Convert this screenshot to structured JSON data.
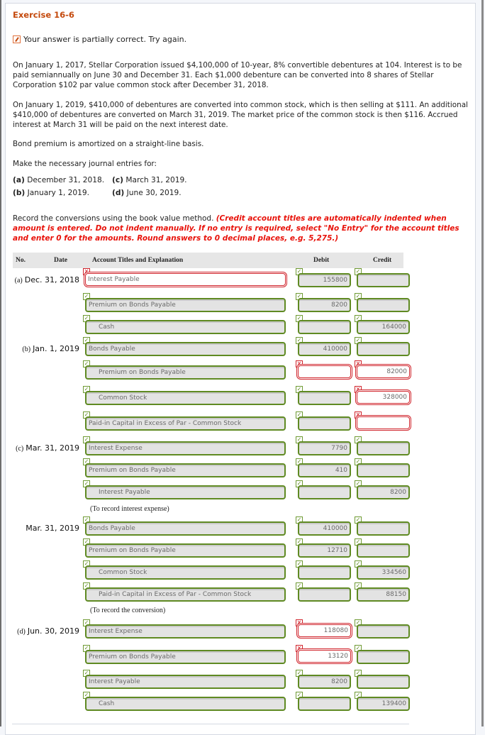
{
  "title": "Exercise 16-6",
  "status": {
    "icon": "pencil-edit-icon",
    "text": "Your answer is partially correct.  Try again."
  },
  "problem": {
    "p1": "On January 1, 2017, Stellar Corporation issued $4,100,000 of 10-year, 8% convertible debentures at 104. Interest is to be paid semiannually on June 30 and December 31. Each $1,000 debenture can be converted into 8 shares of Stellar Corporation $102 par value common stock after December 31, 2018.",
    "p2": "On January 1, 2019, $410,000 of debentures are converted into common stock, which is then selling at $111. An additional $410,000 of debentures are converted on March 31, 2019. The market price of the common stock is then $116. Accrued interest at March 31 will be paid on the next interest date.",
    "p3": "Bond premium is amortized on a straight-line basis.",
    "p4": "Make the necessary journal entries for:",
    "parts": [
      {
        "label": "(a)",
        "text": "December 31, 2018."
      },
      {
        "label": "(c)",
        "text": "March 31, 2019."
      },
      {
        "label": "(b)",
        "text": "January 1, 2019."
      },
      {
        "label": "(d)",
        "text": "June 30, 2019."
      }
    ]
  },
  "instructions": {
    "plain": "Record the conversions using the book value method. ",
    "emphasis": "(Credit account titles are automatically indented when amount is entered. Do not indent manually. If no entry is required, select \"No Entry\" for the account titles and enter 0 for the amounts. Round answers to 0 decimal places, e.g. 5,275.)"
  },
  "table": {
    "headers": {
      "no": "No.",
      "date": "Date",
      "account": "Account Titles and Explanation",
      "debit": "Debit",
      "credit": "Credit"
    },
    "status_colors": {
      "correct": "#5f8a22",
      "incorrect": "#d0242c"
    },
    "rows": [
      {
        "part": "(a)",
        "date": "Dec. 31, 2018",
        "account": "Interest Payable",
        "indent": false,
        "account_ok": false,
        "debit": "155800",
        "debit_ok": true,
        "credit": "",
        "credit_ok": true
      },
      {
        "part": "",
        "date": "",
        "account": "Premium on Bonds Payable",
        "indent": false,
        "account_ok": true,
        "debit": "8200",
        "debit_ok": true,
        "credit": "",
        "credit_ok": true
      },
      {
        "part": "",
        "date": "",
        "account": "Cash",
        "indent": true,
        "account_ok": true,
        "debit": "",
        "debit_ok": true,
        "credit": "164000",
        "credit_ok": true
      },
      {
        "part": "(b)",
        "date": "Jan. 1, 2019",
        "account": "Bonds Payable",
        "indent": false,
        "account_ok": true,
        "debit": "410000",
        "debit_ok": true,
        "credit": "",
        "credit_ok": true
      },
      {
        "part": "",
        "date": "",
        "account": "Premium on Bonds Payable",
        "indent": true,
        "account_ok": true,
        "debit": "",
        "debit_ok": false,
        "credit": "82000",
        "credit_ok": false
      },
      {
        "part": "",
        "date": "",
        "account": "Common Stock",
        "indent": true,
        "account_ok": true,
        "debit": "",
        "debit_ok": true,
        "credit": "328000",
        "credit_ok": false
      },
      {
        "part": "",
        "date": "",
        "account": "Paid-in Capital in Excess of Par - Common Stock",
        "indent": false,
        "account_ok": true,
        "debit": "",
        "debit_ok": true,
        "credit": "",
        "credit_ok": false
      },
      {
        "part": "(c)",
        "date": "Mar. 31, 2019",
        "account": "Interest Expense",
        "indent": false,
        "account_ok": true,
        "debit": "7790",
        "debit_ok": true,
        "credit": "",
        "credit_ok": true
      },
      {
        "part": "",
        "date": "",
        "account": "Premium on Bonds Payable",
        "indent": false,
        "account_ok": true,
        "debit": "410",
        "debit_ok": true,
        "credit": "",
        "credit_ok": true
      },
      {
        "part": "",
        "date": "",
        "account": "Interest Payable",
        "indent": true,
        "account_ok": true,
        "debit": "",
        "debit_ok": true,
        "credit": "8200",
        "credit_ok": true
      },
      {
        "part": "",
        "date": "Mar. 31, 2019",
        "account": "Bonds Payable",
        "indent": false,
        "account_ok": true,
        "debit": "410000",
        "debit_ok": true,
        "credit": "",
        "credit_ok": true
      },
      {
        "part": "",
        "date": "",
        "account": "Premium on Bonds Payable",
        "indent": false,
        "account_ok": true,
        "debit": "12710",
        "debit_ok": true,
        "credit": "",
        "credit_ok": true
      },
      {
        "part": "",
        "date": "",
        "account": "Common Stock",
        "indent": true,
        "account_ok": true,
        "debit": "",
        "debit_ok": true,
        "credit": "334560",
        "credit_ok": true
      },
      {
        "part": "",
        "date": "",
        "account": "Paid-in Capital in Excess of Par - Common Stock",
        "indent": true,
        "account_ok": true,
        "debit": "",
        "debit_ok": true,
        "credit": "88150",
        "credit_ok": true
      },
      {
        "part": "(d)",
        "date": "Jun. 30, 2019",
        "account": "Interest Expense",
        "indent": false,
        "account_ok": true,
        "debit": "118080",
        "debit_ok": false,
        "credit": "",
        "credit_ok": true
      },
      {
        "part": "",
        "date": "",
        "account": "Premium on Bonds Payable",
        "indent": false,
        "account_ok": true,
        "debit": "13120",
        "debit_ok": false,
        "credit": "",
        "credit_ok": true
      },
      {
        "part": "",
        "date": "",
        "account": "Interest Payable",
        "indent": false,
        "account_ok": true,
        "debit": "8200",
        "debit_ok": true,
        "credit": "",
        "credit_ok": true
      },
      {
        "part": "",
        "date": "",
        "account": "Cash",
        "indent": true,
        "account_ok": true,
        "debit": "",
        "debit_ok": true,
        "credit": "139400",
        "credit_ok": true
      }
    ],
    "notes": [
      {
        "after_row": 9,
        "text": "(To record interest expense)"
      },
      {
        "after_row": 13,
        "text": "(To record the conversion)"
      }
    ]
  }
}
